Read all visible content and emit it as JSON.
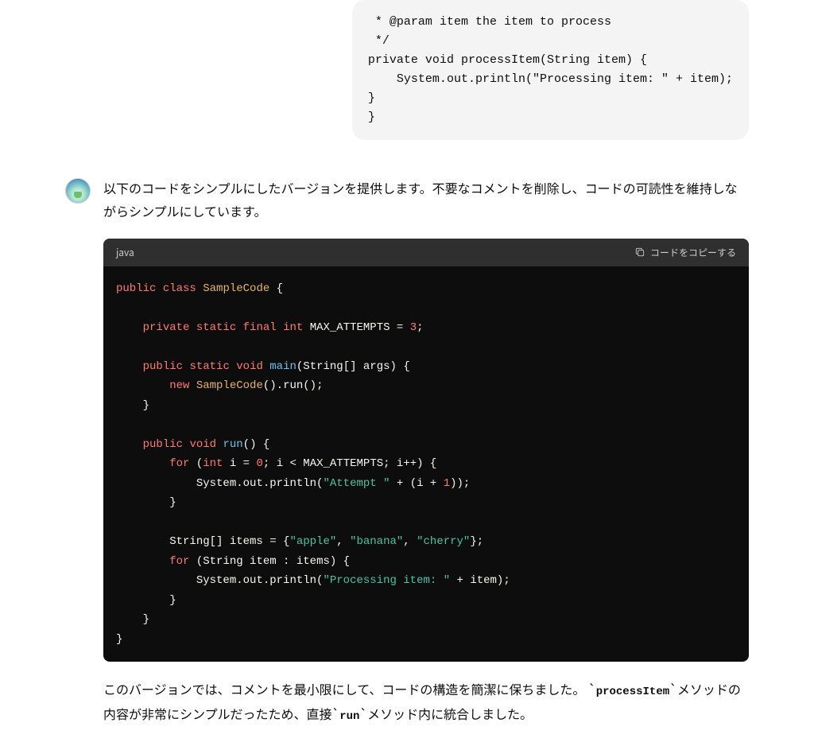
{
  "user_message": {
    "code_lines": [
      " * @param item the item to process",
      " */",
      "private void processItem(String item) {",
      "    System.out.println(\"Processing item: \" + item);",
      "}",
      "}"
    ]
  },
  "assistant": {
    "intro": "以下のコードをシンプルにしたバージョンを提供します。不要なコメントを削除し、コードの可読性を維持しながらシンプルにしています。",
    "code_language": "java",
    "copy_label": "コードをコピーする",
    "code_tokens": [
      [
        [
          "kw",
          "public"
        ],
        [
          "sp",
          " "
        ],
        [
          "kw",
          "class"
        ],
        [
          "sp",
          " "
        ],
        [
          "class",
          "SampleCode"
        ],
        [
          "pl",
          " {"
        ]
      ],
      [],
      [
        [
          "sp",
          "    "
        ],
        [
          "kw",
          "private"
        ],
        [
          "sp",
          " "
        ],
        [
          "kw",
          "static"
        ],
        [
          "sp",
          " "
        ],
        [
          "kw",
          "final"
        ],
        [
          "sp",
          " "
        ],
        [
          "type",
          "int"
        ],
        [
          "pl",
          " MAX_ATTEMPTS = "
        ],
        [
          "num",
          "3"
        ],
        [
          "pl",
          ";"
        ]
      ],
      [],
      [
        [
          "sp",
          "    "
        ],
        [
          "kw",
          "public"
        ],
        [
          "sp",
          " "
        ],
        [
          "kw",
          "static"
        ],
        [
          "sp",
          " "
        ],
        [
          "type",
          "void"
        ],
        [
          "sp",
          " "
        ],
        [
          "main",
          "main"
        ],
        [
          "pl",
          "(String[] args) {"
        ]
      ],
      [
        [
          "sp",
          "        "
        ],
        [
          "kw",
          "new"
        ],
        [
          "sp",
          " "
        ],
        [
          "class",
          "SampleCode"
        ],
        [
          "pl",
          "().run();"
        ]
      ],
      [
        [
          "sp",
          "    "
        ],
        [
          "pl",
          "}"
        ]
      ],
      [],
      [
        [
          "sp",
          "    "
        ],
        [
          "kw",
          "public"
        ],
        [
          "sp",
          " "
        ],
        [
          "type",
          "void"
        ],
        [
          "sp",
          " "
        ],
        [
          "fn",
          "run"
        ],
        [
          "pl",
          "() {"
        ]
      ],
      [
        [
          "sp",
          "        "
        ],
        [
          "kw",
          "for"
        ],
        [
          "pl",
          " ("
        ],
        [
          "type",
          "int"
        ],
        [
          "pl",
          " i = "
        ],
        [
          "num",
          "0"
        ],
        [
          "pl",
          "; i < MAX_ATTEMPTS; i++) {"
        ]
      ],
      [
        [
          "sp",
          "            "
        ],
        [
          "pl",
          "System.out.println("
        ],
        [
          "str",
          "\"Attempt \""
        ],
        [
          "pl",
          " + (i + "
        ],
        [
          "num",
          "1"
        ],
        [
          "pl",
          "));"
        ]
      ],
      [
        [
          "sp",
          "        "
        ],
        [
          "pl",
          "}"
        ]
      ],
      [],
      [
        [
          "sp",
          "        "
        ],
        [
          "pl",
          "String[] items = {"
        ],
        [
          "str",
          "\"apple\""
        ],
        [
          "pl",
          ", "
        ],
        [
          "str",
          "\"banana\""
        ],
        [
          "pl",
          ", "
        ],
        [
          "str",
          "\"cherry\""
        ],
        [
          "pl",
          "};"
        ]
      ],
      [
        [
          "sp",
          "        "
        ],
        [
          "kw",
          "for"
        ],
        [
          "pl",
          " (String item : items) {"
        ]
      ],
      [
        [
          "sp",
          "            "
        ],
        [
          "pl",
          "System.out.println("
        ],
        [
          "str",
          "\"Processing item: \""
        ],
        [
          "pl",
          " + item);"
        ]
      ],
      [
        [
          "sp",
          "        "
        ],
        [
          "pl",
          "}"
        ]
      ],
      [
        [
          "sp",
          "    "
        ],
        [
          "pl",
          "}"
        ]
      ],
      [
        [
          "pl",
          "}"
        ]
      ]
    ],
    "explanation_parts": {
      "p1": "このバージョンでは、コメントを最小限にして、コードの構造を簡潔に保ちました。",
      "code1": "processItem",
      "p2": "メソッドの内容が非常にシンプルだったため、直接",
      "code2": "run",
      "p3": "メソッド内に統合しました。"
    }
  }
}
